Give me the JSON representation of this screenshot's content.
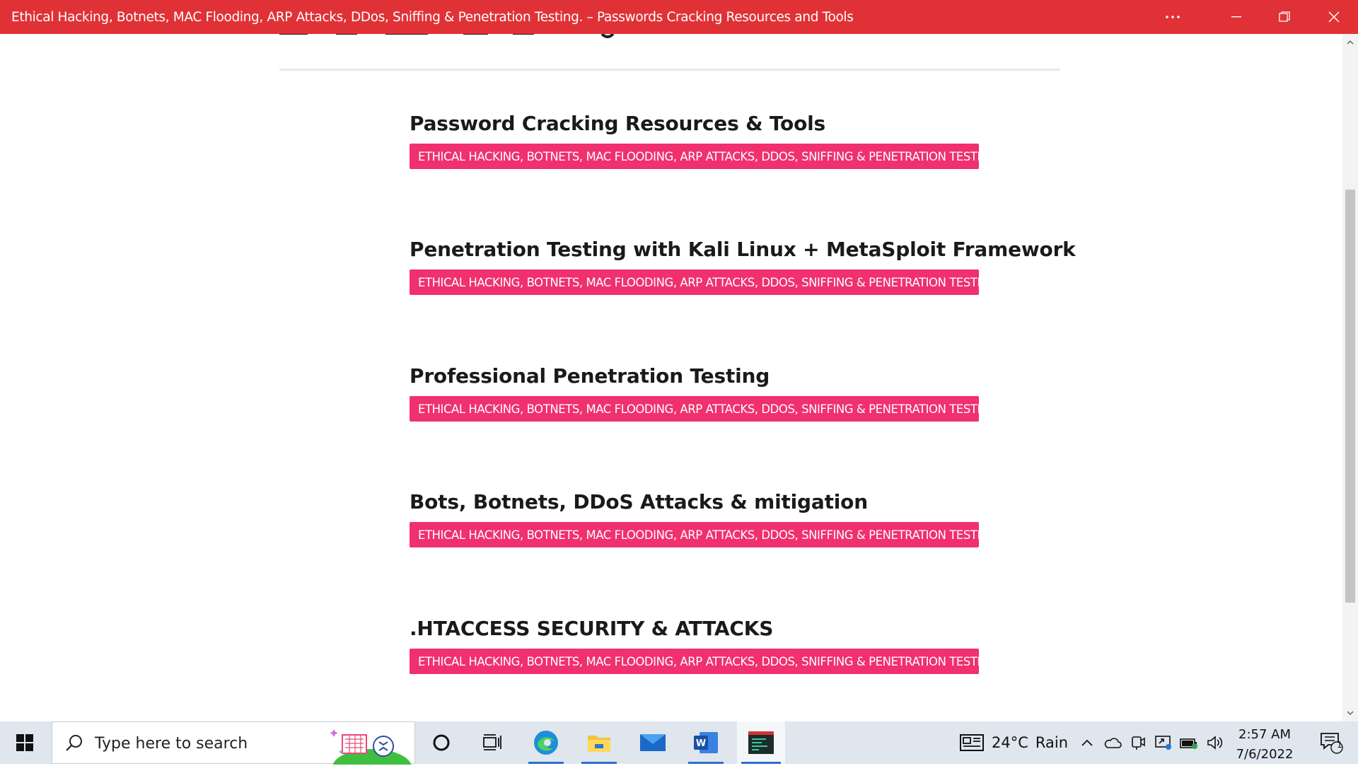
{
  "window": {
    "title": "Ethical Hacking, Botnets, MAC Flooding, ARP Attacks, DDos, Sniffing & Penetration Testing. – Passwords Cracking Resources and Tools",
    "controls": [
      "more-options",
      "minimize",
      "restore",
      "close"
    ]
  },
  "page": {
    "cut_heading": "",
    "posts": [
      {
        "title": "Password Cracking Resources & Tools",
        "tag": "ETHICAL HACKING, BOTNETS, MAC FLOODING, ARP ATTACKS, DDOS, SNIFFING & PENETRATION TESTING."
      },
      {
        "title": "Penetration Testing with Kali Linux + MetaSploit Framework",
        "tag": "ETHICAL HACKING, BOTNETS, MAC FLOODING, ARP ATTACKS, DDOS, SNIFFING & PENETRATION TESTING."
      },
      {
        "title": "Professional Penetration Testing",
        "tag": "ETHICAL HACKING, BOTNETS, MAC FLOODING, ARP ATTACKS, DDOS, SNIFFING & PENETRATION TESTING."
      },
      {
        "title": "Bots, Botnets, DDoS Attacks & mitigation",
        "tag": "ETHICAL HACKING, BOTNETS, MAC FLOODING, ARP ATTACKS, DDOS, SNIFFING & PENETRATION TESTING."
      },
      {
        "title": ".HTACCESS SECURITY & ATTACKS",
        "tag": "ETHICAL HACKING, BOTNETS, MAC FLOODING, ARP ATTACKS, DDOS, SNIFFING & PENETRATION TESTING."
      }
    ]
  },
  "taskbar": {
    "search_placeholder": "Type here to search",
    "apps": [
      "cortana-icon",
      "task-view-icon",
      "edge-icon",
      "file-explorer-icon",
      "mail-icon",
      "word-icon",
      "active-app-icon"
    ],
    "weather": {
      "temp": "24°C",
      "condition": "Rain"
    },
    "clock": {
      "time": "2:57 AM",
      "date": "7/6/2022"
    },
    "notification_count": "1"
  },
  "colors": {
    "titlebar": "#e03236",
    "tag_background": "#f0306f",
    "taskbar": "#dfe6ee"
  }
}
